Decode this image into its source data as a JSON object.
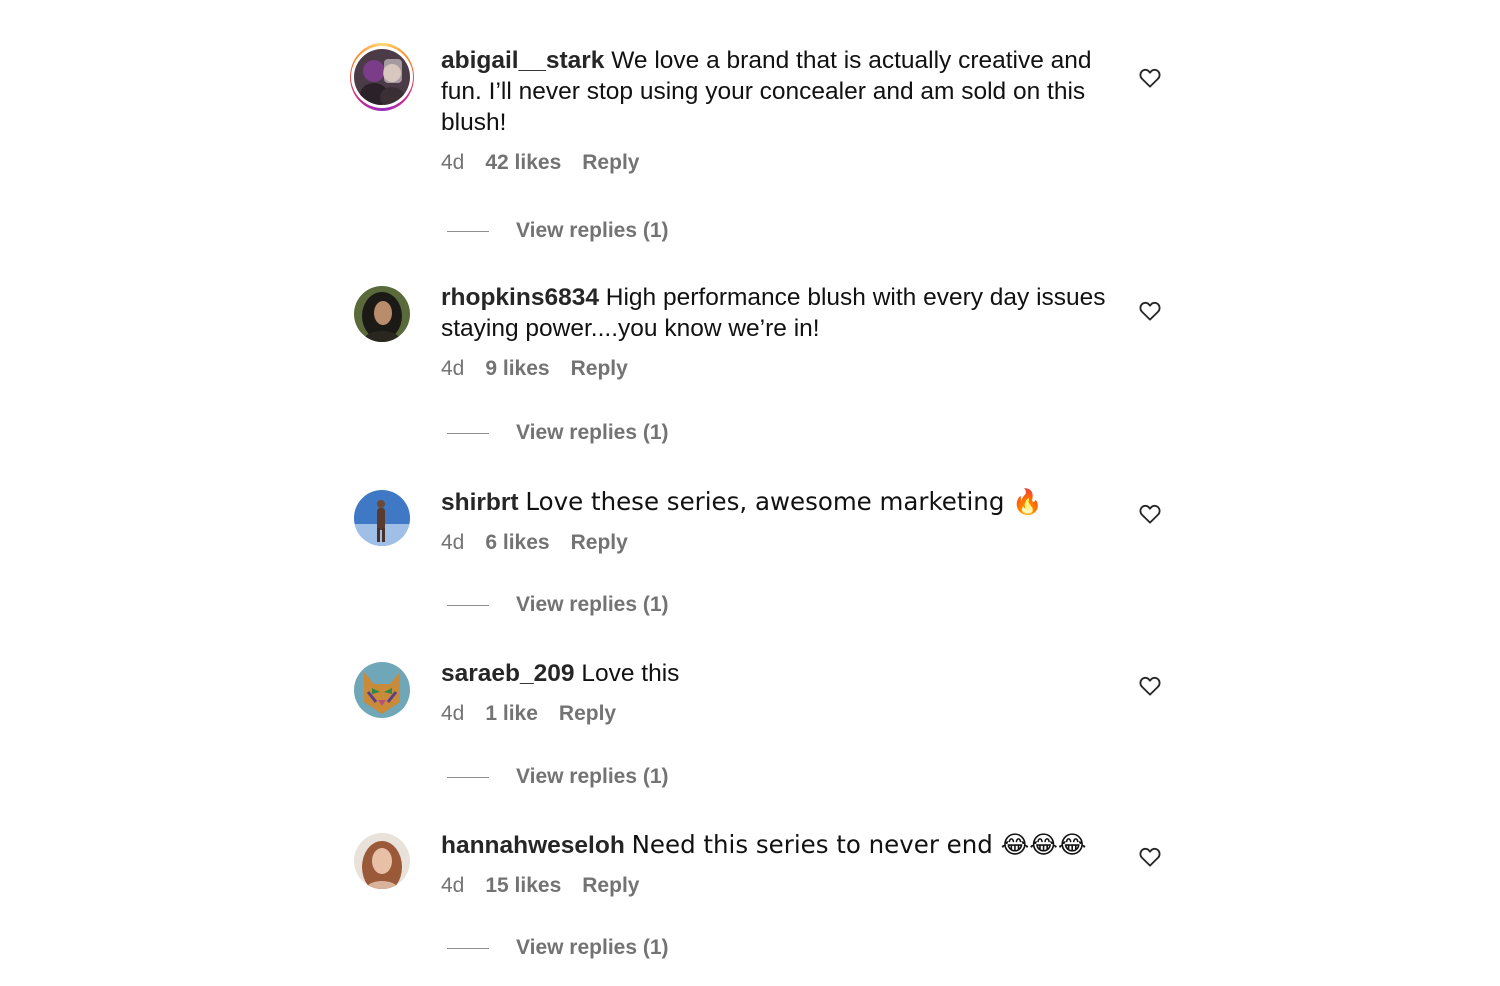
{
  "comments": [
    {
      "username": "abigail__stark",
      "text": "We love a brand that is actually creative and fun. I’ll never stop using your concealer and am sold on this blush!",
      "age": "4d",
      "likes": "42 likes",
      "reply_label": "Reply",
      "view_replies": "View replies (1)",
      "avatar_has_story_ring": true
    },
    {
      "username": "rhopkins6834",
      "text": "High performance blush with every day issues staying power....you know we’re in!",
      "age": "4d",
      "likes": "9 likes",
      "reply_label": "Reply",
      "view_replies": "View replies (1)"
    },
    {
      "username": "shirbrt",
      "text": "Love these series, awesome marketing 🔥",
      "age": "4d",
      "likes": "6 likes",
      "reply_label": "Reply",
      "view_replies": "View replies (1)"
    },
    {
      "username": "saraeb_209",
      "text": "Love this",
      "age": "4d",
      "likes": "1 like",
      "reply_label": "Reply",
      "view_replies": "View replies (1)"
    },
    {
      "username": "hannahweseloh",
      "text": "Need this series to never end 😂😂😂",
      "age": "4d",
      "likes": "15 likes",
      "reply_label": "Reply",
      "view_replies": "View replies (1)"
    }
  ],
  "icons": {
    "like": "heart-outline-icon"
  },
  "colors": {
    "text_primary": "#262626",
    "text_secondary": "#737373",
    "story_ring_start": "#feda75",
    "story_ring_end": "#d62976"
  }
}
